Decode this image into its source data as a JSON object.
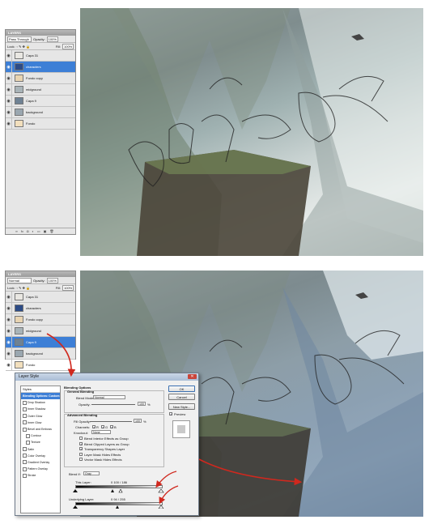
{
  "layers_panel_top": {
    "title": "LAYERS",
    "blend_mode": "Pass Through",
    "opacity_label": "Opacity:",
    "opacity_value": "100%",
    "lock_label": "Lock:",
    "fill_label": "Fill:",
    "fill_value": "100%",
    "layers": [
      {
        "name": "Capa 31",
        "active": false,
        "thumb": "#e9e7e2"
      },
      {
        "name": "characters",
        "active": true,
        "thumb": "#2c4b86"
      },
      {
        "name": "Fondo copy",
        "active": false,
        "thumb": "#e8d4b2"
      },
      {
        "name": "midground",
        "active": false,
        "thumb": "#a9b4b8"
      },
      {
        "name": "Capa 9",
        "active": false,
        "thumb": "#6f8294"
      },
      {
        "name": "background",
        "active": false,
        "thumb": "#9aa7b0"
      },
      {
        "name": "Fondo",
        "active": false,
        "thumb": "#f2dfbd"
      }
    ]
  },
  "layers_panel_bottom": {
    "title": "LAYERS",
    "blend_mode": "Normal",
    "opacity_label": "Opacity:",
    "opacity_value": "100%",
    "lock_label": "Lock:",
    "fill_label": "Fill:",
    "fill_value": "100%",
    "layers": [
      {
        "name": "Capa 31",
        "active": false,
        "thumb": "#e9e7e2"
      },
      {
        "name": "characters",
        "active": false,
        "thumb": "#2c4b86"
      },
      {
        "name": "Fondo copy",
        "active": false,
        "thumb": "#e8d4b2"
      },
      {
        "name": "midground",
        "active": false,
        "thumb": "#a9b4b8"
      },
      {
        "name": "Capa 9",
        "active": true,
        "thumb": "#6f8294"
      },
      {
        "name": "background",
        "active": false,
        "thumb": "#9aa7b0"
      },
      {
        "name": "Fondo",
        "active": false,
        "thumb": "#f2dfbd"
      }
    ]
  },
  "layer_style": {
    "title": "Layer Style",
    "styles_header": "Styles",
    "styles": [
      {
        "label": "Blending Options: Custom",
        "selected": true,
        "checkbox": false
      },
      {
        "label": "Drop Shadow",
        "selected": false,
        "checkbox": true
      },
      {
        "label": "Inner Shadow",
        "selected": false,
        "checkbox": true
      },
      {
        "label": "Outer Glow",
        "selected": false,
        "checkbox": true
      },
      {
        "label": "Inner Glow",
        "selected": false,
        "checkbox": true
      },
      {
        "label": "Bevel and Emboss",
        "selected": false,
        "checkbox": true
      },
      {
        "label": "Contour",
        "selected": false,
        "checkbox": true
      },
      {
        "label": "Texture",
        "selected": false,
        "checkbox": true
      },
      {
        "label": "Satin",
        "selected": false,
        "checkbox": true
      },
      {
        "label": "Color Overlay",
        "selected": false,
        "checkbox": true
      },
      {
        "label": "Gradient Overlay",
        "selected": false,
        "checkbox": true
      },
      {
        "label": "Pattern Overlay",
        "selected": false,
        "checkbox": true
      },
      {
        "label": "Stroke",
        "selected": false,
        "checkbox": true
      }
    ],
    "blending_options_heading": "Blending Options",
    "general_blending_heading": "General Blending",
    "blend_mode_label": "Blend Mode:",
    "blend_mode_value": "Normal",
    "opacity_label": "Opacity:",
    "opacity_value": "100",
    "percent": "%",
    "advanced_blending_heading": "Advanced Blending",
    "fill_opacity_label": "Fill Opacity:",
    "fill_opacity_value": "100",
    "channels_label": "Channels:",
    "channel_r": "R",
    "channel_g": "G",
    "channel_b": "B",
    "knockout_label": "Knockout:",
    "knockout_value": "None",
    "advanced_options": [
      {
        "label": "Blend Interior Effects as Group",
        "checked": false
      },
      {
        "label": "Blend Clipped Layers as Group",
        "checked": true
      },
      {
        "label": "Transparency Shapes Layer",
        "checked": true
      },
      {
        "label": "Layer Mask Hides Effects",
        "checked": false
      },
      {
        "label": "Vector Mask Hides Effects",
        "checked": false
      }
    ],
    "blend_if_label": "Blend If:",
    "blend_if_value": "Gray",
    "this_layer_label": "This Layer:",
    "this_layer_values": "0     100 / 186",
    "underlying_layer_label": "Underlying Layer:",
    "underlying_layer_values": "0     94 / 255",
    "buttons": {
      "ok": "OK",
      "cancel": "Cancel",
      "new_style": "New Style...",
      "preview": "Preview"
    },
    "preview_checked": true
  },
  "colors": {
    "selection_blue": "#3d7fd6",
    "annotation_red": "#d0281e"
  }
}
